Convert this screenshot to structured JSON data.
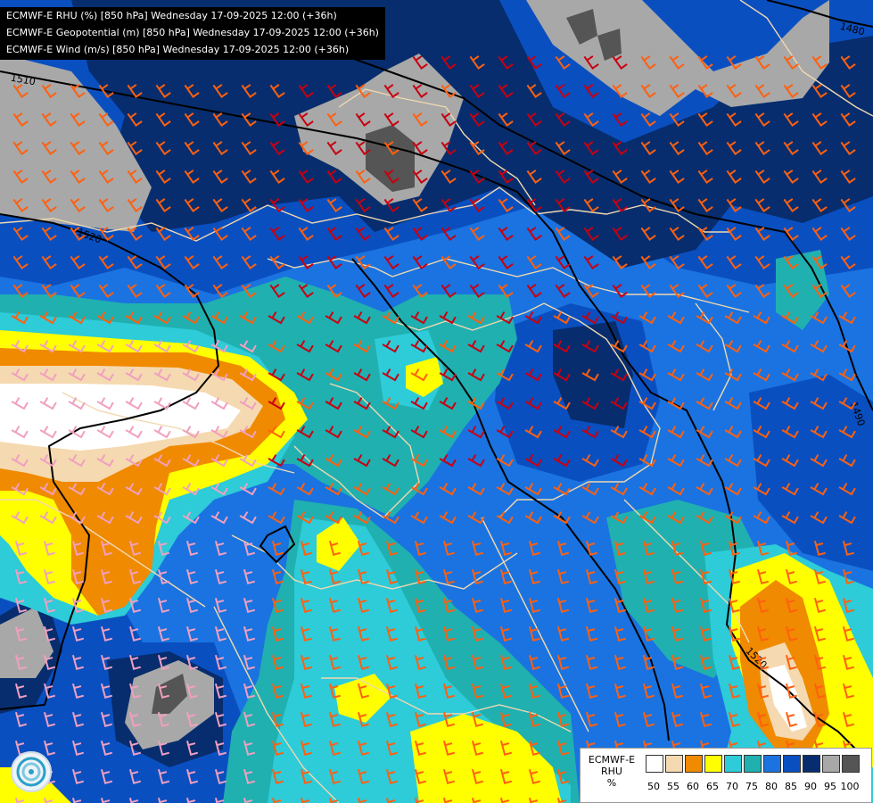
{
  "header": {
    "lines": [
      "ECMWF-E RHU (%) [850 hPa] Wednesday 17-09-2025 12:00 (+36h)",
      "ECMWF-E Geopotential (m) [850 hPa] Wednesday 17-09-2025 12:00 (+36h)",
      "ECMWF-E Wind (m/s) [850 hPa] Wednesday 17-09-2025 12:00 (+36h)"
    ]
  },
  "legend": {
    "title_line1": "ECMWF-E",
    "title_line2": "RHU",
    "unit": "%",
    "ticks": [
      "50",
      "55",
      "60",
      "65",
      "70",
      "75",
      "80",
      "85",
      "90",
      "95",
      "100"
    ],
    "colors": [
      "#ffffff",
      "#f5d9b0",
      "#f08a00",
      "#ffff00",
      "#2ecbd8",
      "#20b0b0",
      "#1a73e0",
      "#0a4fc0",
      "#072d6e",
      "#a8a8a8",
      "#555555"
    ]
  },
  "contours": {
    "labels": [
      "1480",
      "1510",
      "1520",
      "1490",
      "1520"
    ]
  },
  "colors": {
    "rhu_80": "#1a73e0",
    "rhu_85": "#0a4fc0",
    "rhu_90": "#072d6e",
    "rhu_95": "#a8a8a8",
    "rhu_100": "#555555",
    "rhu_75": "#20b0b0",
    "rhu_70": "#2ecbd8",
    "rhu_65": "#ffff00",
    "rhu_60": "#f08a00",
    "rhu_55": "#f5d9b0",
    "rhu_50": "#ffffff",
    "barb_strong": "#c80010",
    "barb_medium": "#ff6010",
    "barb_light": "#f0a0c0",
    "border": "#f0d8b0",
    "geopotential": "#000000"
  },
  "logo": {
    "icon": "ogimet-swirl-icon"
  }
}
